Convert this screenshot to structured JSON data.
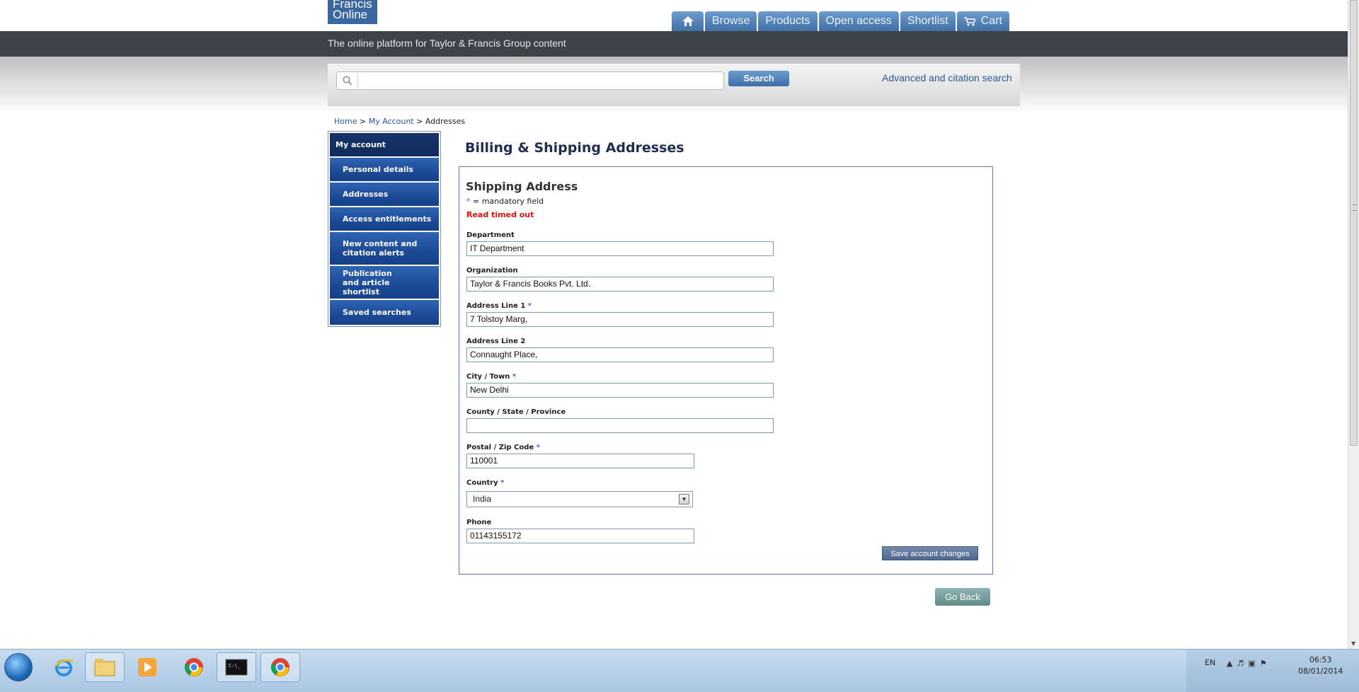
{
  "header": {
    "logo_line1": "Francis",
    "logo_line2": "Online",
    "tagline": "The online platform for Taylor & Francis Group content",
    "nav": [
      {
        "label": "",
        "icon": "home-icon"
      },
      {
        "label": "Browse"
      },
      {
        "label": "Products"
      },
      {
        "label": "Open access"
      },
      {
        "label": "Shortlist"
      },
      {
        "label": "Cart",
        "icon": "cart-icon"
      }
    ]
  },
  "search": {
    "value": "",
    "button_label": "Search",
    "advanced_link": "Advanced and citation search"
  },
  "breadcrumb": {
    "home": "Home",
    "sep1": " > ",
    "account": "My Account",
    "sep2": " > ",
    "current": "Addresses"
  },
  "sidebar": {
    "items": [
      {
        "label": "My account"
      },
      {
        "label": "Personal details"
      },
      {
        "label": "Addresses"
      },
      {
        "label": "Access entitlements"
      },
      {
        "label": "New content and citation alerts"
      },
      {
        "label": "Publication and article shortlist"
      },
      {
        "label": "Saved searches"
      }
    ]
  },
  "main": {
    "page_title": "Billing & Shipping Addresses",
    "section_title": "Shipping Address",
    "mandatory_star": "*",
    "mandatory_note": " = mandatory field",
    "error": "Read timed out",
    "fields": {
      "department": {
        "label": "Department",
        "value": "IT Department"
      },
      "organization": {
        "label": "Organization",
        "value": "Taylor & Francis Books Pvt. Ltd."
      },
      "address1": {
        "label": "Address Line 1",
        "value": "7 Tolstoy Marg,"
      },
      "address2": {
        "label": "Address Line 2",
        "value": "Connaught Place,"
      },
      "city": {
        "label": "City / Town",
        "value": "New Delhi"
      },
      "county": {
        "label": "County / State / Province",
        "value": ""
      },
      "postal": {
        "label": "Postal / Zip Code",
        "value": "110001"
      },
      "country": {
        "label": "Country",
        "value": "India"
      },
      "phone": {
        "label": "Phone",
        "value": "01143155172"
      }
    },
    "save_label": "Save account changes",
    "go_back_label": "Go Back"
  },
  "taskbar": {
    "lang": "EN",
    "time": "06:53",
    "date": "08/01/2014"
  }
}
